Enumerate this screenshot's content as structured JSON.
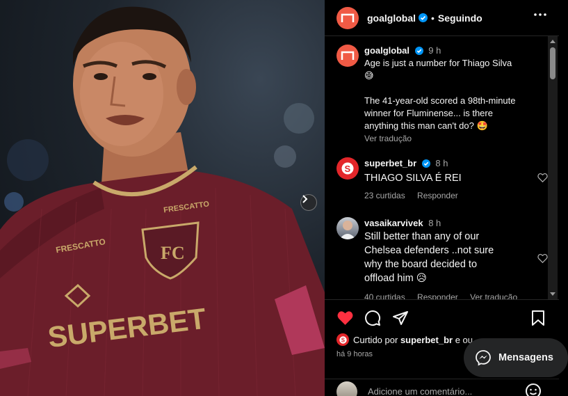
{
  "post": {
    "author": "goalglobal",
    "follow_status": "Seguindo",
    "caption_time": "9 h",
    "caption_lines": [
      "Age is just a number for Thiago Silva",
      "😅",
      "The 41-year-old scored a 98th-minute",
      "winner for Fluminense... is there",
      "anything this man can't do? 🤩"
    ],
    "translate_label": "Ver tradução"
  },
  "photo": {
    "jersey_sponsor": "SUPERBET",
    "jersey_brand": "FRESCATTO"
  },
  "comments": [
    {
      "user": "superbet_br",
      "verified": true,
      "time": "8 h",
      "text": "THIAGO SILVA É REI",
      "likes": "23 curtidas",
      "reply": "Responder"
    },
    {
      "user": "vasaikarvivek",
      "verified": false,
      "time": "8 h",
      "lines": [
        "Still better than any of our",
        "Chelsea defenders ..not sure",
        "why the board decided to",
        "offload him 😥"
      ],
      "likes": "40 curtidas",
      "reply": "Responder",
      "translate": "Ver tradução"
    }
  ],
  "likes_summary": {
    "prefix": "Curtido por",
    "user": "superbet_br",
    "suffix": "e ou"
  },
  "posted_ago": "há 9 horas",
  "add_comment_placeholder": "Adicione um comentário...",
  "messages_button": "Mensagens",
  "colors": {
    "brand": "#f05a45",
    "like": "#ff3040",
    "superbet": "#e3262a",
    "verified": "#0095f6"
  },
  "icons": [
    "verified-badge-icon",
    "more-options-icon",
    "heart-icon",
    "comment-icon",
    "share-icon",
    "save-icon",
    "emoji-icon",
    "messenger-icon",
    "chevron-right-icon"
  ]
}
